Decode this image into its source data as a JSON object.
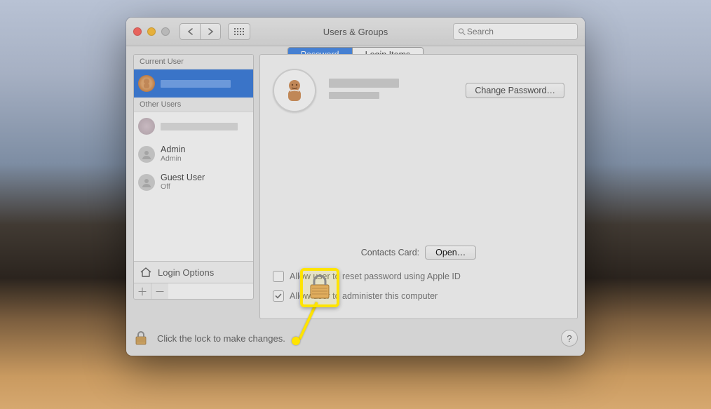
{
  "window": {
    "title": "Users & Groups",
    "search_placeholder": "Search"
  },
  "segmented": {
    "password": "Password",
    "login_items": "Login Items"
  },
  "sidebar": {
    "section_current": "Current User",
    "section_other": "Other Users",
    "current_user_name": "",
    "other1_name": "",
    "admin_name": "Admin",
    "admin_role": "Admin",
    "guest_name": "Guest User",
    "guest_status": "Off",
    "login_options": "Login Options"
  },
  "main": {
    "change_password": "Change Password…",
    "contacts_label": "Contacts Card:",
    "open": "Open…",
    "allow_reset": "Allow user to reset password using Apple ID",
    "allow_admin": "Allow user to administer this computer"
  },
  "footer": {
    "lock_text": "Click the lock to make changes.",
    "help": "?"
  },
  "buttons": {
    "plus": "＋",
    "minus": "－"
  }
}
